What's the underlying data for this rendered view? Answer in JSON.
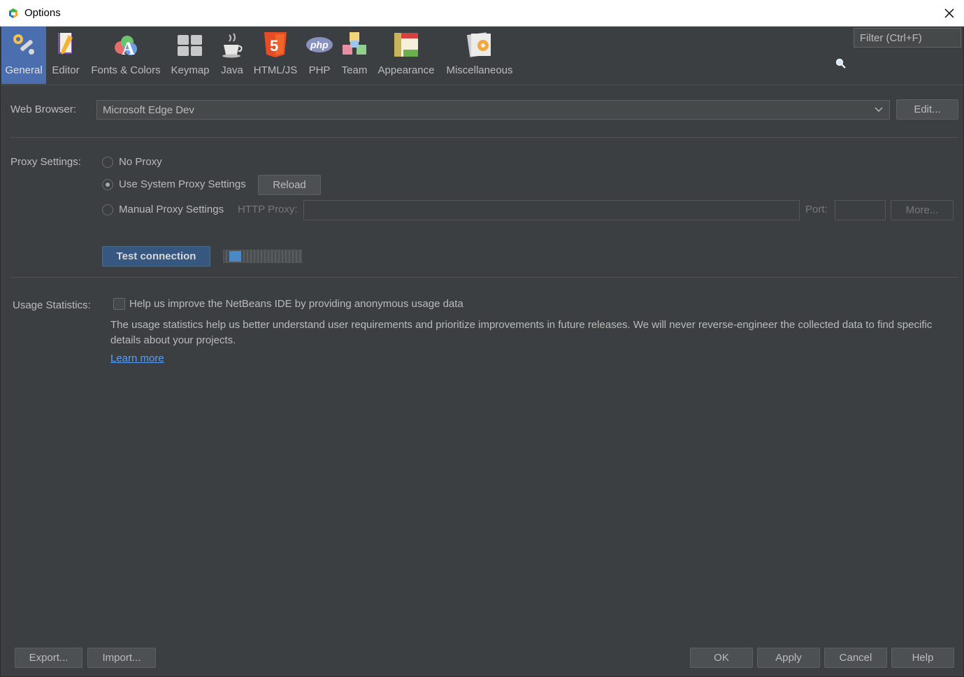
{
  "window": {
    "title": "Options"
  },
  "toolbar": {
    "categories": [
      {
        "label": "General",
        "icon": "general-wrench-gear-icon",
        "selected": true
      },
      {
        "label": "Editor",
        "icon": "editor-pencil-icon"
      },
      {
        "label": "Fonts & Colors",
        "icon": "fonts-colors-icon"
      },
      {
        "label": "Keymap",
        "icon": "keymap-keyboard-icon"
      },
      {
        "label": "Java",
        "icon": "java-cup-icon"
      },
      {
        "label": "HTML/JS",
        "icon": "html5-icon"
      },
      {
        "label": "PHP",
        "icon": "php-icon"
      },
      {
        "label": "Team",
        "icon": "team-cubes-icon"
      },
      {
        "label": "Appearance",
        "icon": "appearance-icon"
      },
      {
        "label": "Miscellaneous",
        "icon": "miscellaneous-icon"
      }
    ],
    "filter_placeholder": "Filter (Ctrl+F)"
  },
  "web_browser": {
    "label": "Web Browser:",
    "value": "Microsoft Edge Dev",
    "edit_button": "Edit..."
  },
  "proxy": {
    "label": "Proxy Settings:",
    "no_proxy": "No Proxy",
    "system_proxy": "Use System Proxy Settings",
    "reload_button": "Reload",
    "manual_proxy": "Manual Proxy Settings",
    "http_proxy_label": "HTTP Proxy:",
    "port_label": "Port:",
    "more_button": "More...",
    "selected": "system_proxy",
    "test_button": "Test connection"
  },
  "usage": {
    "label": "Usage Statistics:",
    "checkbox_label": "Help us improve the NetBeans IDE by providing anonymous usage data",
    "description": "The usage statistics help us better understand user requirements and prioritize improvements in future releases. We will never reverse-engineer the collected data to find specific details about your projects.",
    "learn_more": "Learn more"
  },
  "footer": {
    "export": "Export...",
    "import": "Import...",
    "ok": "OK",
    "apply": "Apply",
    "cancel": "Cancel",
    "help": "Help"
  },
  "colors": {
    "background": "#3c3f41",
    "selected_category": "#4b6eaf",
    "link": "#589df6",
    "primary_button": "#365880"
  }
}
